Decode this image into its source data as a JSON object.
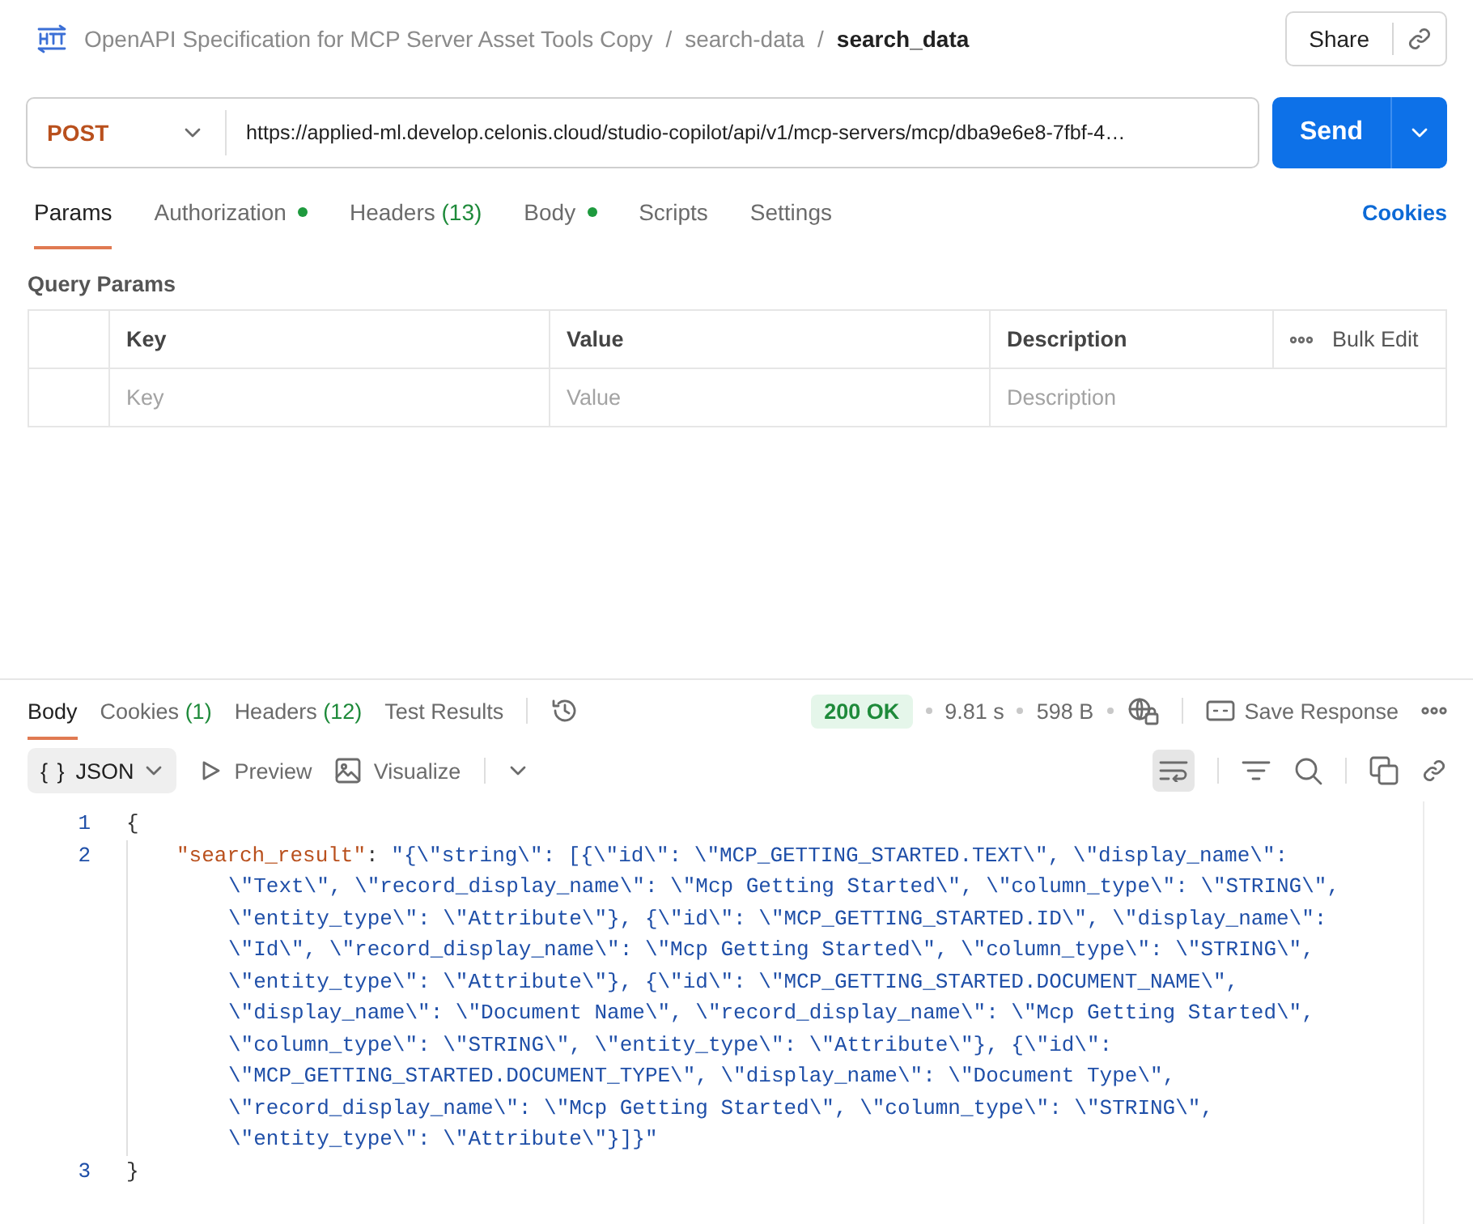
{
  "breadcrumb": {
    "parents": [
      "OpenAPI Specification for MCP Server Asset Tools Copy",
      "search-data"
    ],
    "separator": "/",
    "current": "search_data"
  },
  "share_label": "Share",
  "request": {
    "method": "POST",
    "url": "https://applied-ml.develop.celonis.cloud/studio-copilot/api/v1/mcp-servers/mcp/dba9e6e8-7fbf-4…",
    "send_label": "Send"
  },
  "request_tabs": [
    {
      "label": "Params",
      "dot": false,
      "selected": true
    },
    {
      "label": "Authorization",
      "dot": true,
      "selected": false
    },
    {
      "label": "Headers",
      "count": "(13)",
      "dot": false,
      "selected": false
    },
    {
      "label": "Body",
      "dot": true,
      "selected": false
    },
    {
      "label": "Scripts",
      "dot": false,
      "selected": false
    },
    {
      "label": "Settings",
      "dot": false,
      "selected": false
    }
  ],
  "cookies_link": "Cookies",
  "query_params": {
    "title": "Query Params",
    "columns": [
      "Key",
      "Value",
      "Description"
    ],
    "bulk_edit": "Bulk Edit",
    "placeholders": [
      "Key",
      "Value",
      "Description"
    ]
  },
  "response_tabs": [
    {
      "label": "Body",
      "selected": true
    },
    {
      "label": "Cookies",
      "count": "(1)",
      "selected": false
    },
    {
      "label": "Headers",
      "count": "(12)",
      "selected": false
    },
    {
      "label": "Test Results",
      "selected": false
    }
  ],
  "response_meta": {
    "status": "200 OK",
    "time": "9.81 s",
    "size": "598 B",
    "save_label": "Save Response"
  },
  "viewer": {
    "format_icon": "{ }",
    "format": "JSON",
    "preview": "Preview",
    "visualize": "Visualize",
    "wrap_lines": true
  },
  "code_lines": [
    {
      "number": "1",
      "kind": "plain",
      "text": "{"
    },
    {
      "number": "2",
      "kind": "pair",
      "key": "\"search_result\"",
      "colon": ":",
      "value": "\"{\\\"string\\\": [{\\\"id\\\": \\\"MCP_GETTING_STARTED.TEXT\\\", \\\"display_name\\\": \\\"Text\\\", \\\"record_display_name\\\": \\\"Mcp Getting Started\\\", \\\"column_type\\\": \\\"STRING\\\", \\\"entity_type\\\": \\\"Attribute\\\"}, {\\\"id\\\": \\\"MCP_GETTING_STARTED.ID\\\", \\\"display_name\\\": \\\"Id\\\", \\\"record_display_name\\\": \\\"Mcp Getting Started\\\", \\\"column_type\\\": \\\"STRING\\\", \\\"entity_type\\\": \\\"Attribute\\\"}, {\\\"id\\\": \\\"MCP_GETTING_STARTED.DOCUMENT_NAME\\\", \\\"display_name\\\": \\\"Document Name\\\", \\\"record_display_name\\\": \\\"Mcp Getting Started\\\", \\\"column_type\\\": \\\"STRING\\\", \\\"entity_type\\\": \\\"Attribute\\\"}, {\\\"id\\\": \\\"MCP_GETTING_STARTED.DOCUMENT_TYPE\\\", \\\"display_name\\\": \\\"Document Type\\\", \\\"record_display_name\\\": \\\"Mcp Getting Started\\\", \\\"column_type\\\": \\\"STRING\\\", \\\"entity_type\\\": \\\"Attribute\\\"}]}\""
    },
    {
      "number": "3",
      "kind": "plain",
      "text": "}"
    }
  ]
}
